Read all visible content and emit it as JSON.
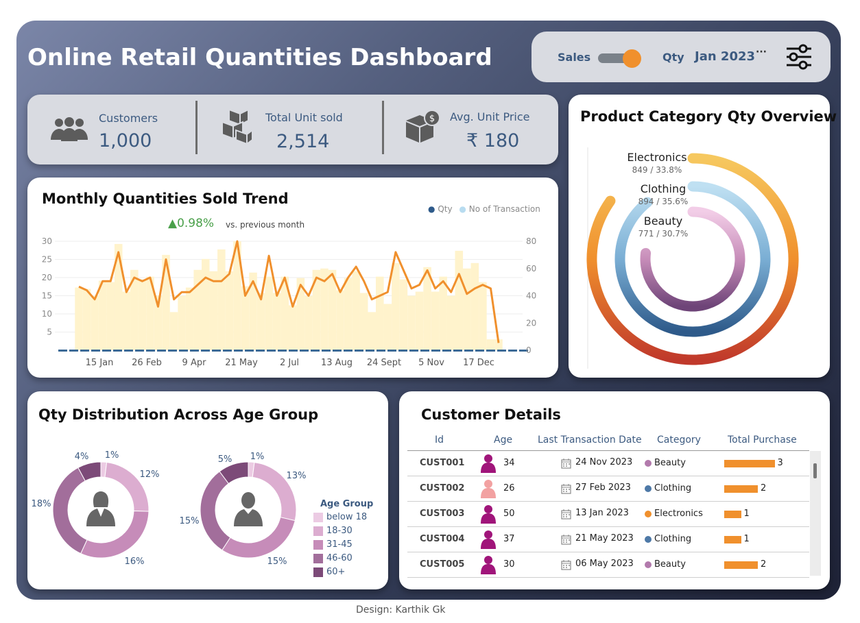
{
  "header": {
    "title": "Online Retail Quantities Dashboard"
  },
  "toggle": {
    "left_label": "Sales",
    "right_label": "Qty",
    "period": "Jan 2023",
    "period_more": "···"
  },
  "kpis": [
    {
      "label": "Customers",
      "value": "1,000",
      "icon": "people-icon"
    },
    {
      "label": "Total Unit sold",
      "value": "2,514",
      "icon": "boxes-icon"
    },
    {
      "label": "Avg. Unit Price",
      "value": "₹ 180",
      "icon": "box-price-icon"
    }
  ],
  "trend": {
    "title": "Monthly Quantities Sold Trend",
    "change_arrow": "▲",
    "change_value": "0.98%",
    "change_text": "vs. previous month",
    "legend": [
      "Qty",
      "No of Transaction"
    ],
    "colors": {
      "qty": "#f0902d",
      "transactions": "#fff3cc",
      "dot_qty": "#2e5a8a",
      "dot_txn": "#b8dcf0"
    }
  },
  "chart_data": [
    {
      "type": "line",
      "title": "Monthly Quantities Sold Trend",
      "x_ticks": [
        "15 Jan",
        "26 Feb",
        "9 Apr",
        "21 May",
        "2 Jul",
        "13 Aug",
        "24 Sept",
        "5 Nov",
        "17 Dec"
      ],
      "y_left": {
        "ticks": [
          5,
          10,
          15,
          20,
          25,
          30
        ],
        "range": [
          0,
          30
        ]
      },
      "y_right": {
        "ticks": [
          0,
          20,
          40,
          60,
          80
        ],
        "range": [
          0,
          80
        ]
      },
      "series": [
        {
          "name": "Qty",
          "axis": "left",
          "values": [
            17.5,
            16.5,
            14,
            19,
            19,
            27,
            16,
            20,
            19,
            20,
            12,
            25,
            14,
            16,
            16,
            18,
            20,
            19,
            19,
            21,
            30,
            15,
            19,
            14,
            26,
            15,
            20,
            12,
            18,
            15,
            20,
            19,
            21,
            16,
            20,
            23,
            19,
            14,
            15,
            16,
            27,
            22,
            17,
            18,
            22,
            17,
            19,
            16,
            21,
            15.5,
            17,
            18,
            17,
            2
          ]
        },
        {
          "name": "No of Transaction",
          "axis": "right",
          "values": [
            46,
            45,
            40,
            51,
            50,
            78,
            43,
            59,
            52,
            54,
            40,
            70,
            28,
            40,
            46,
            59,
            67,
            58,
            74,
            58,
            80,
            47,
            57,
            42,
            54,
            42,
            54,
            33,
            53,
            40,
            59,
            60,
            59,
            44,
            53,
            58,
            42,
            28,
            54,
            34,
            64,
            52,
            40,
            43,
            61,
            43,
            54,
            40,
            73,
            60,
            64,
            50,
            8,
            8
          ]
        }
      ]
    },
    {
      "type": "pie",
      "title": "Product Category Qty Overview",
      "categories": [
        "Electronics",
        "Clothing",
        "Beauty"
      ],
      "values": [
        849,
        894,
        771
      ],
      "percent": [
        33.8,
        35.6,
        30.7
      ]
    },
    {
      "type": "pie",
      "title": "Qty Distribution Across Age Group",
      "subset": "female",
      "categories": [
        "below 18",
        "18-30",
        "31-45",
        "46-60",
        "60+"
      ],
      "values": [
        1,
        12,
        16,
        18,
        4
      ]
    },
    {
      "type": "pie",
      "title": "Qty Distribution Across Age Group",
      "subset": "male",
      "categories": [
        "below 18",
        "18-30",
        "31-45",
        "46-60",
        "60+"
      ],
      "values": [
        1,
        13,
        15,
        15,
        5
      ]
    },
    {
      "type": "table",
      "title": "Customer Details",
      "columns": [
        "Id",
        "Age",
        "Last Transaction Date",
        "Category",
        "Total Purchase"
      ],
      "rows": [
        [
          "CUST001",
          34,
          "24 Nov 2023",
          "Beauty",
          3
        ],
        [
          "CUST002",
          26,
          "27 Feb 2023",
          "Clothing",
          2
        ],
        [
          "CUST003",
          50,
          "13 Jan 2023",
          "Electronics",
          1
        ],
        [
          "CUST004",
          37,
          "21 May 2023",
          "Clothing",
          1
        ],
        [
          "CUST005",
          30,
          "06 May 2023",
          "Beauty",
          2
        ]
      ]
    }
  ],
  "category": {
    "title": "Product Category Qty Overview",
    "items": [
      {
        "name": "Electronics",
        "detail": "849 / 33.8%"
      },
      {
        "name": "Clothing",
        "detail": "894 / 35.6%"
      },
      {
        "name": "Beauty",
        "detail": "771 / 30.7%"
      }
    ]
  },
  "age": {
    "title": "Qty Distribution Across Age Group",
    "legend_title": "Age Group",
    "groups": [
      "below 18",
      "18-30",
      "31-45",
      "46-60",
      "60+"
    ],
    "colors": [
      "#eccbe3",
      "#dcadd0",
      "#c68cb9",
      "#a26e9b",
      "#7c4a78"
    ],
    "female_labels": [
      "1%",
      "12%",
      "16%",
      "18%",
      "4%"
    ],
    "male_labels": [
      "1%",
      "13%",
      "15%",
      "15%",
      "5%"
    ]
  },
  "customers": {
    "title": "Customer Details",
    "columns": [
      "Id",
      "Age",
      "Last Transaction Date",
      "Category",
      "Total Purchase"
    ],
    "rows": [
      {
        "id": "CUST001",
        "age": "34",
        "date": "24 Nov 2023",
        "category": "Beauty",
        "purchase": "3",
        "gender": "male",
        "cat_color": "#b27aac",
        "bar": 3
      },
      {
        "id": "CUST002",
        "age": "26",
        "date": "27 Feb 2023",
        "category": "Clothing",
        "purchase": "2",
        "gender": "female",
        "cat_color": "#4e79a7",
        "bar": 2
      },
      {
        "id": "CUST003",
        "age": "50",
        "date": "13 Jan 2023",
        "category": "Electronics",
        "purchase": "1",
        "gender": "male",
        "cat_color": "#f0902d",
        "bar": 1
      },
      {
        "id": "CUST004",
        "age": "37",
        "date": "21 May 2023",
        "category": "Clothing",
        "purchase": "1",
        "gender": "male",
        "cat_color": "#4e79a7",
        "bar": 1
      },
      {
        "id": "CUST005",
        "age": "30",
        "date": "06 May 2023",
        "category": "Beauty",
        "purchase": "2",
        "gender": "male",
        "cat_color": "#b27aac",
        "bar": 2
      }
    ]
  },
  "footer": {
    "credit": "Design: Karthik Gk"
  }
}
